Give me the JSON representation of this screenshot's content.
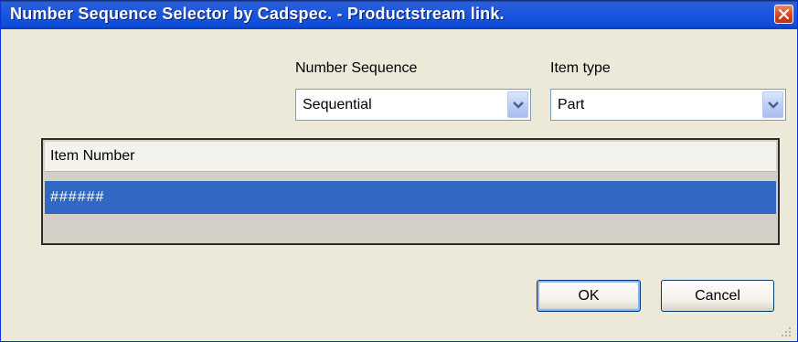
{
  "window": {
    "title": "Number Sequence Selector by Cadspec. - Productstream link."
  },
  "number_sequence": {
    "label": "Number Sequence",
    "value": "Sequential"
  },
  "item_type": {
    "label": "Item type",
    "value": "Part"
  },
  "grid": {
    "column_header": "Item Number",
    "rows": [
      "######"
    ]
  },
  "buttons": {
    "ok": "OK",
    "cancel": "Cancel"
  },
  "colors": {
    "titlebar": "#0f4fd8",
    "selection": "#3168c4",
    "dialog_background": "#ece9d8"
  },
  "icons": {
    "close": "close-icon",
    "dropdown": "chevron-down-icon",
    "resize": "resize-grip-icon"
  }
}
